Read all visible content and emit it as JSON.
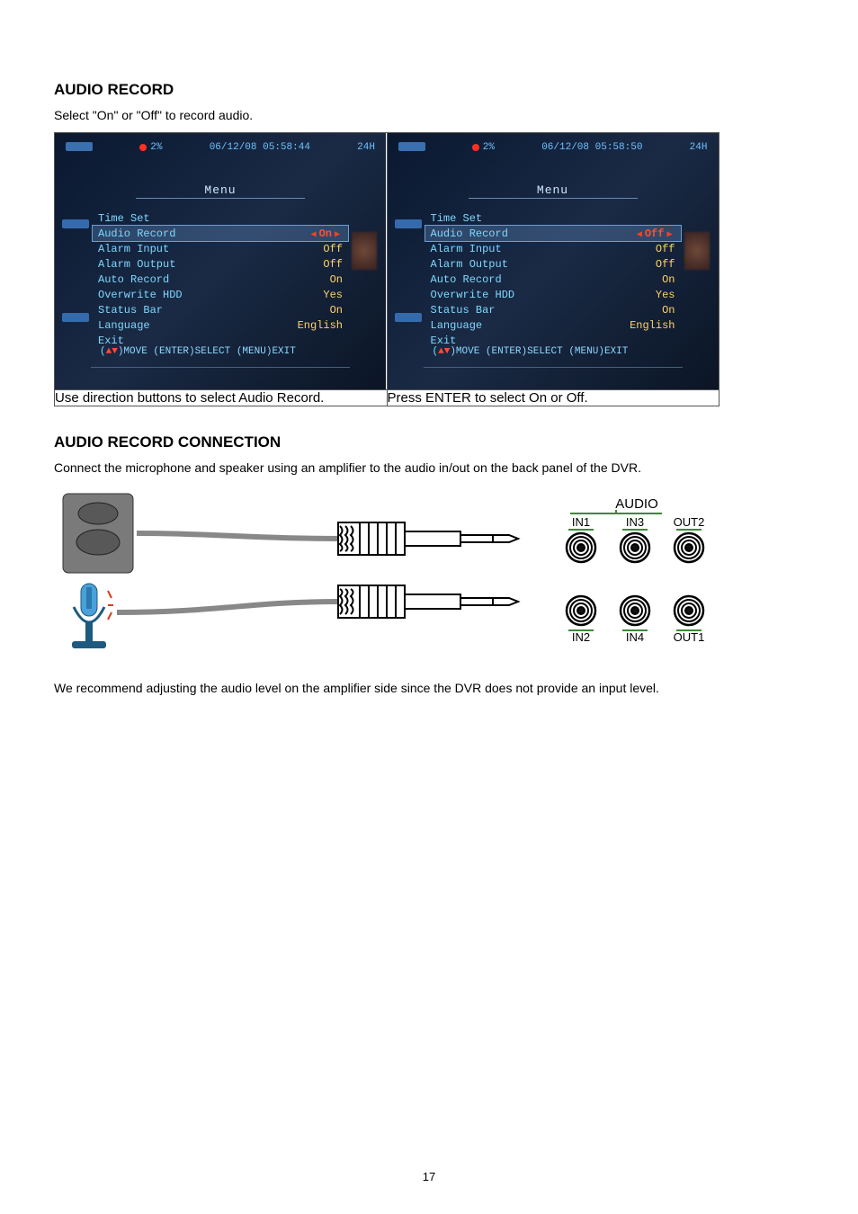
{
  "section": {
    "heading": "AUDIO RECORD",
    "intro": "Select \"On\" or \"Off\" to record audio."
  },
  "shots": {
    "left": {
      "datetime": "06/12/08 05:58:44",
      "mode": "24H",
      "pct": "2%",
      "title": "Menu",
      "rows": [
        {
          "label": "Time Set",
          "val": ""
        },
        {
          "label": "Audio Record",
          "val": "On",
          "hl": true
        },
        {
          "label": "Alarm Input",
          "val": "Off"
        },
        {
          "label": "Alarm Output",
          "val": "Off"
        },
        {
          "label": "Auto Record",
          "val": "On"
        },
        {
          "label": "Overwrite HDD",
          "val": "Yes"
        },
        {
          "label": "Status Bar",
          "val": "On"
        },
        {
          "label": "Language",
          "val": "English"
        },
        {
          "label": "Exit",
          "val": ""
        }
      ],
      "hint": "(▲▼)MOVE (ENTER)SELECT (MENU)EXIT",
      "caption": "Use direction buttons to select Audio Record."
    },
    "right": {
      "datetime": "06/12/08 05:58:50",
      "mode": "24H",
      "pct": "2%",
      "title": "Menu",
      "rows": [
        {
          "label": "Time Set",
          "val": ""
        },
        {
          "label": "Audio Record",
          "val": "Off",
          "hl": true
        },
        {
          "label": "Alarm Input",
          "val": "Off"
        },
        {
          "label": "Alarm Output",
          "val": "Off"
        },
        {
          "label": "Auto Record",
          "val": "On"
        },
        {
          "label": "Overwrite HDD",
          "val": "Yes"
        },
        {
          "label": "Status Bar",
          "val": "On"
        },
        {
          "label": "Language",
          "val": "English"
        },
        {
          "label": "Exit",
          "val": ""
        }
      ],
      "hint": "(▲▼)MOVE (ENTER)SELECT (MENU)EXIT",
      "caption": "Press ENTER to select On or Off."
    }
  },
  "connection": {
    "heading": "AUDIO RECORD CONNECTION",
    "para1": "Connect the microphone and speaker using an amplifier to the audio in/out on the back panel of the DVR.",
    "para2": "We recommend adjusting the audio level on the amplifier side since the DVR does not provide an input level."
  },
  "panel": {
    "title": "AUDIO",
    "jacks": [
      "IN1",
      "IN3",
      "OUT2",
      "IN2",
      "IN4",
      "OUT1"
    ],
    "frame_color": "#3a8a3a"
  },
  "icons": {
    "speaker": "speaker-icon",
    "mic": "mic-icon",
    "rca": "rca-plug-icon"
  },
  "page_number": "17"
}
